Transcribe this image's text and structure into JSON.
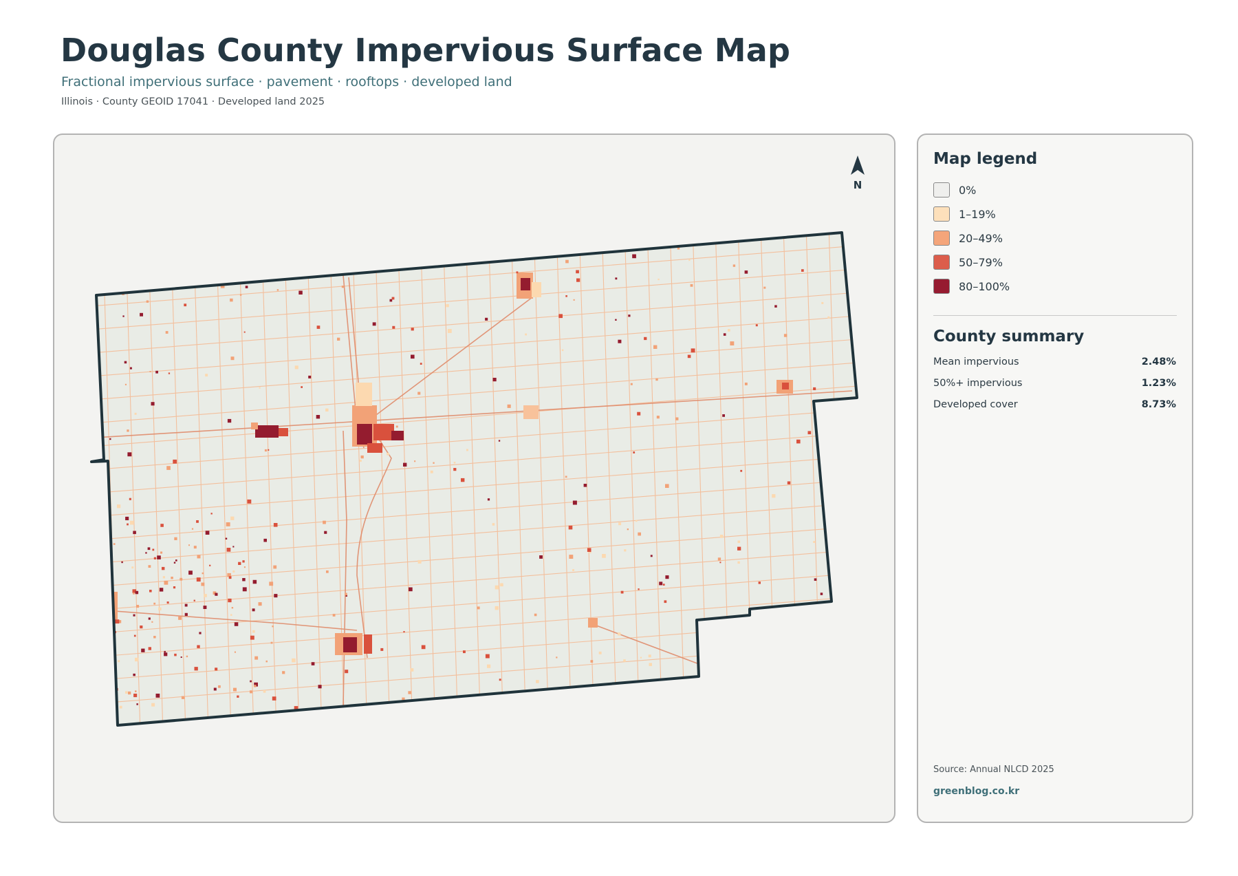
{
  "header": {
    "title": "Douglas County Impervious Surface Map",
    "subtitle": "Fractional impervious surface · pavement · rooftops · developed land",
    "caption": "Illinois · County GEOID 17041 · Developed land 2025"
  },
  "map": {
    "north_label": "N",
    "icons": [
      "north-arrow-icon"
    ],
    "colors": {
      "county_fill": "#e9ece6",
      "county_border": "#1f333b",
      "low": "#fcd9b0",
      "mid": "#f2a277",
      "high": "#d9513d",
      "very_high": "#941c2f"
    }
  },
  "legend": {
    "title": "Map legend",
    "items": [
      {
        "label": "0%",
        "color": "#efefed"
      },
      {
        "label": "1–19%",
        "color": "#fde0bb"
      },
      {
        "label": "20–49%",
        "color": "#f4a57a"
      },
      {
        "label": "50–79%",
        "color": "#dc5d4b"
      },
      {
        "label": "80–100%",
        "color": "#961b30"
      }
    ]
  },
  "summary": {
    "title": "County summary",
    "stats": [
      {
        "label": "Mean impervious",
        "value": "2.48%"
      },
      {
        "label": "50%+ impervious",
        "value": "1.23%"
      },
      {
        "label": "Developed cover",
        "value": "8.73%"
      }
    ]
  },
  "footer": {
    "source": "Source: Annual NLCD 2025",
    "brand": "greenblog.co.kr"
  }
}
